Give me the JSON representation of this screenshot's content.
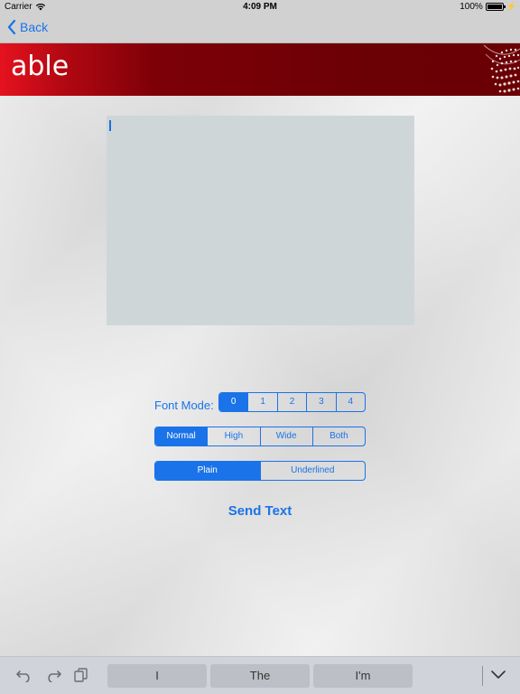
{
  "status_bar": {
    "carrier": "Carrier",
    "time": "4:09 PM",
    "battery": "100%"
  },
  "nav": {
    "back_label": "Back"
  },
  "banner": {
    "logo_text": "able"
  },
  "text_input": {
    "value": ""
  },
  "font_mode": {
    "label": "Font Mode:",
    "options": [
      "0",
      "1",
      "2",
      "3",
      "4"
    ],
    "selected": "0"
  },
  "size_mode": {
    "options": [
      "Normal",
      "High",
      "Wide",
      "Both"
    ],
    "selected": "Normal"
  },
  "style_mode": {
    "options": [
      "Plain",
      "Underlined"
    ],
    "selected": "Plain"
  },
  "send_button": {
    "label": "Send Text"
  },
  "keyboard_bar": {
    "suggestions": [
      "I",
      "The",
      "I'm"
    ]
  },
  "colors": {
    "accent": "#1a73e8",
    "banner_red": "#6b0005",
    "text_area_bg": "#cfd6d8"
  }
}
